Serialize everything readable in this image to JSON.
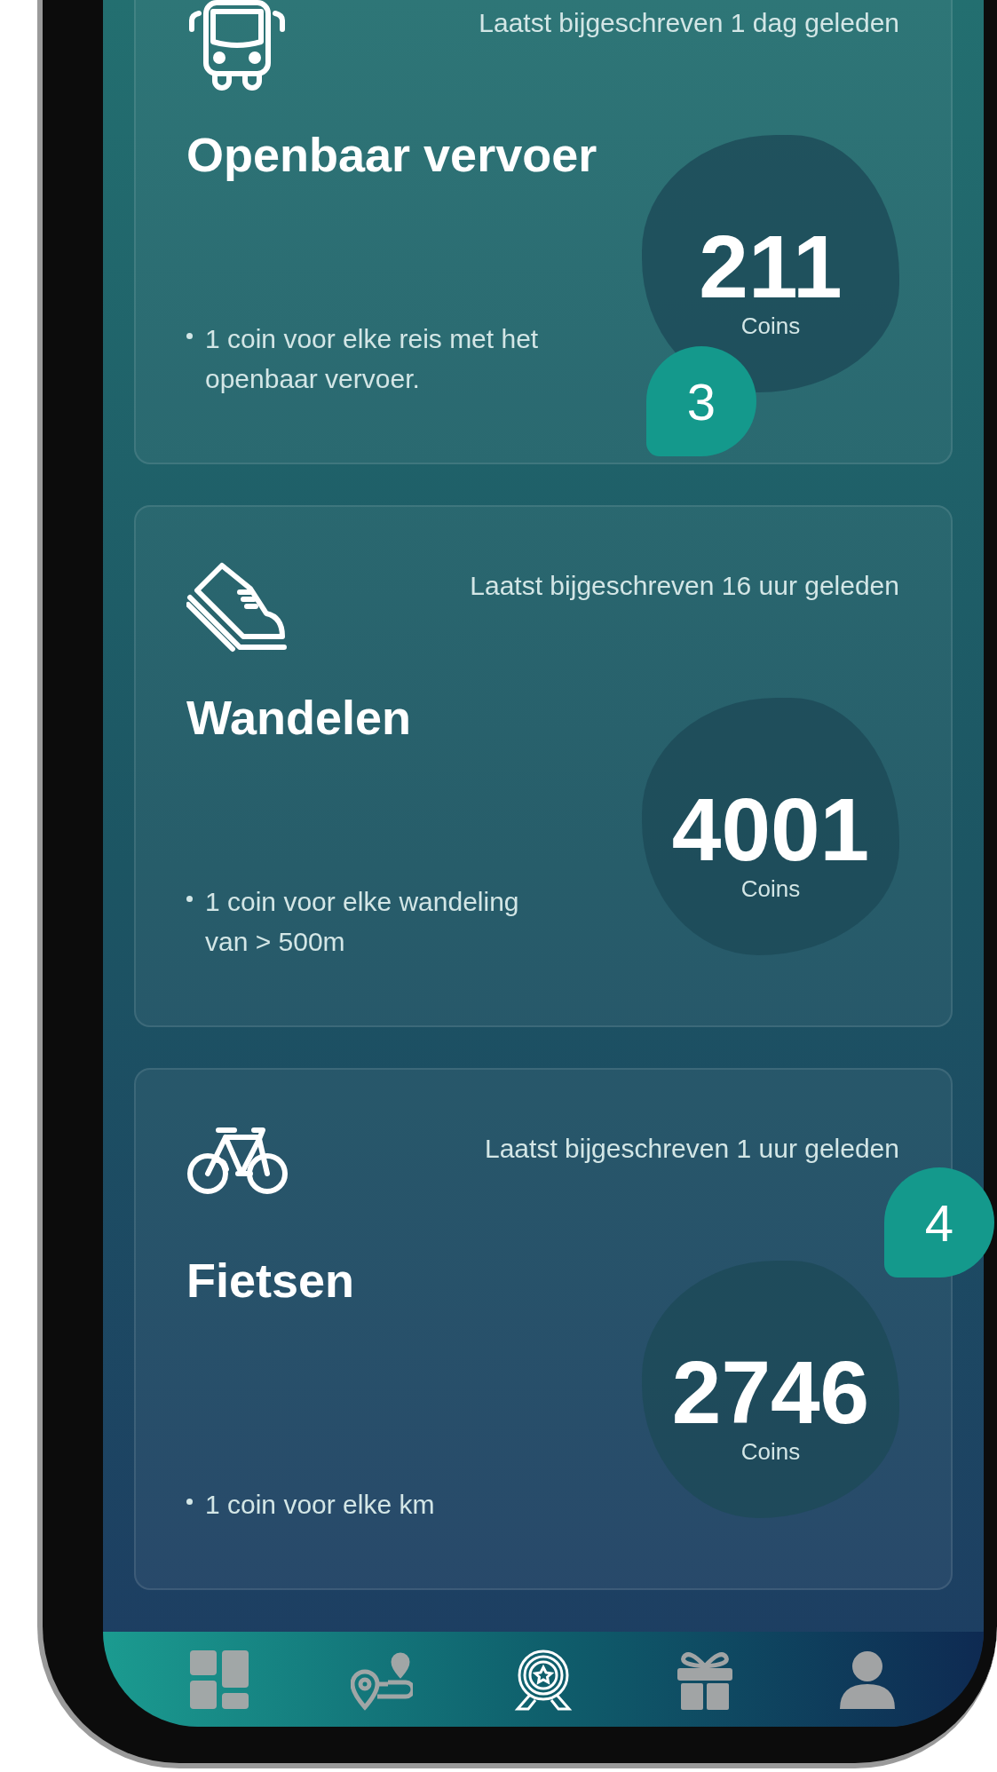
{
  "cards": [
    {
      "kind": "bus",
      "updated": "Laatst bijgeschreven 1 dag geleden",
      "title": "Openbaar vervoer",
      "coins": "211",
      "unit": "Coins",
      "rule": "1 coin voor elke reis met het openbaar vervoer.",
      "marker": "3"
    },
    {
      "kind": "walk",
      "updated": "Laatst bijgeschreven 16 uur geleden",
      "title": "Wandelen",
      "coins": "4001",
      "unit": "Coins",
      "rule": "1 coin voor elke wandeling van > 500m"
    },
    {
      "kind": "bike",
      "updated": "Laatst bijgeschreven 1 uur geleden",
      "title": "Fietsen",
      "coins": "2746",
      "unit": "Coins",
      "rule": "1 coin voor elke km",
      "marker": "4"
    }
  ],
  "nav": [
    {
      "kind": "dashboard",
      "selected": false
    },
    {
      "kind": "route",
      "selected": false
    },
    {
      "kind": "badge",
      "selected": true
    },
    {
      "kind": "gift",
      "selected": false
    },
    {
      "kind": "profile",
      "selected": false
    }
  ]
}
